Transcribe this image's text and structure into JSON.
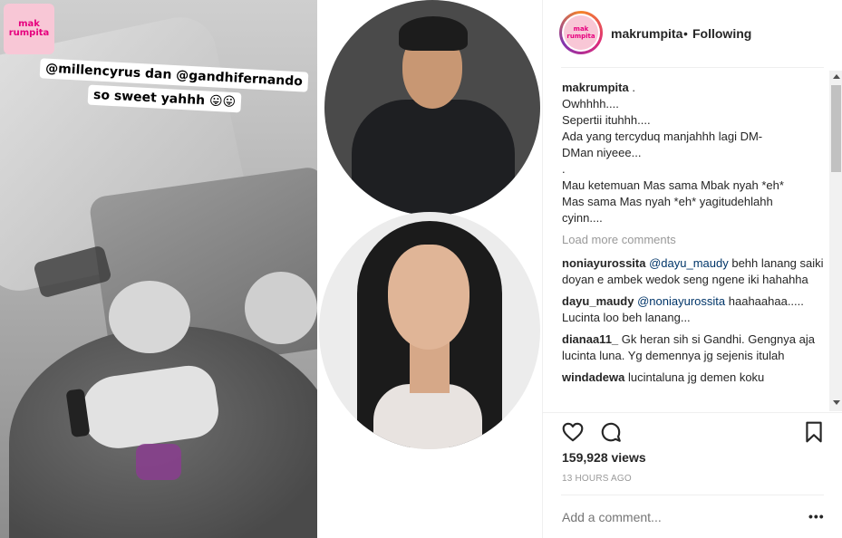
{
  "media": {
    "story_logo": [
      "mak",
      "rumpita"
    ],
    "caption_line1_prefix": "@millencyrus",
    "caption_line1_mid": " dan ",
    "caption_line1_suffix": "@gandhifernando",
    "caption_line2": "so sweet yahhh 😛😛"
  },
  "header": {
    "avatar_logo": [
      "mak",
      "rumpita"
    ],
    "username": "makrumpita",
    "dot": "•",
    "follow_status": "Following"
  },
  "caption": {
    "username": "makrumpita",
    "suffix": " .",
    "lines": [
      "Owhhhh....",
      "Sepertii ituhhh....",
      "Ada yang tercyduq manjahhh lagi DM-",
      "DMan niyeee...",
      ".",
      "Mau ketemuan Mas sama Mbak nyah *eh*",
      "Mas sama Mas nyah *eh* yagitudehlahh",
      "cyinn...."
    ]
  },
  "load_more": "Load more comments",
  "comments": [
    {
      "username": "noniayurossita",
      "mention": "@dayu_maudy",
      "text": " behh lanang saiki doyan e ambek wedok seng ngene iki hahahha"
    },
    {
      "username": "dayu_maudy",
      "mention": "@noniayurossita",
      "text": " haahaahaa..... Lucinta loo beh lanang..."
    },
    {
      "username": "dianaa11_",
      "mention": "",
      "text": " Gk heran sih si Gandhi. Gengnya aja lucinta luna. Yg demennya jg sejenis itulah"
    },
    {
      "username": "windadewa",
      "mention": "",
      "text": " lucintaluna jg demen koku"
    }
  ],
  "stats": {
    "views": "159,928 views",
    "timestamp": "13 HOURS AGO"
  },
  "add_comment": {
    "placeholder": "Add a comment..."
  },
  "more_options": "•••",
  "icons": {
    "like": "heart-icon",
    "comment": "comment-bubble-icon",
    "save": "bookmark-icon"
  }
}
